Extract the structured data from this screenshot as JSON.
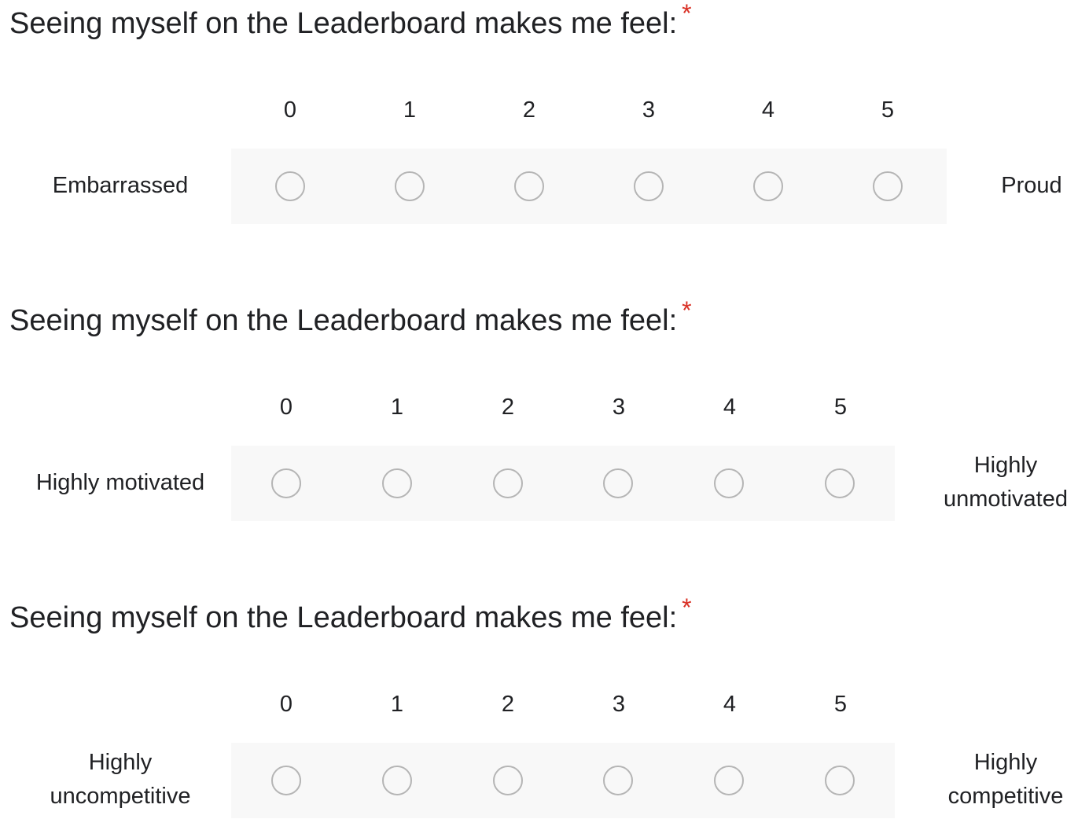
{
  "questions": [
    {
      "title": "Seeing myself on the Leaderboard makes me feel:",
      "required_mark": "*",
      "scale": [
        "0",
        "1",
        "2",
        "3",
        "4",
        "5"
      ],
      "low_label": "Embarrassed",
      "high_label": "Proud",
      "selected": null
    },
    {
      "title": "Seeing myself on the Leaderboard makes me feel:",
      "required_mark": "*",
      "scale": [
        "0",
        "1",
        "2",
        "3",
        "4",
        "5"
      ],
      "low_label": "Highly motivated",
      "high_label": "Highly unmotivated",
      "selected": null
    },
    {
      "title": "Seeing myself on the Leaderboard makes me feel:",
      "required_mark": "*",
      "scale": [
        "0",
        "1",
        "2",
        "3",
        "4",
        "5"
      ],
      "low_label": "Highly uncompetitive",
      "high_label": "Highly competitive",
      "selected": null
    }
  ],
  "colors": {
    "required": "#d93025",
    "radio_border": "#b5b5b5",
    "row_background": "#f8f8f8",
    "text": "#202124"
  }
}
